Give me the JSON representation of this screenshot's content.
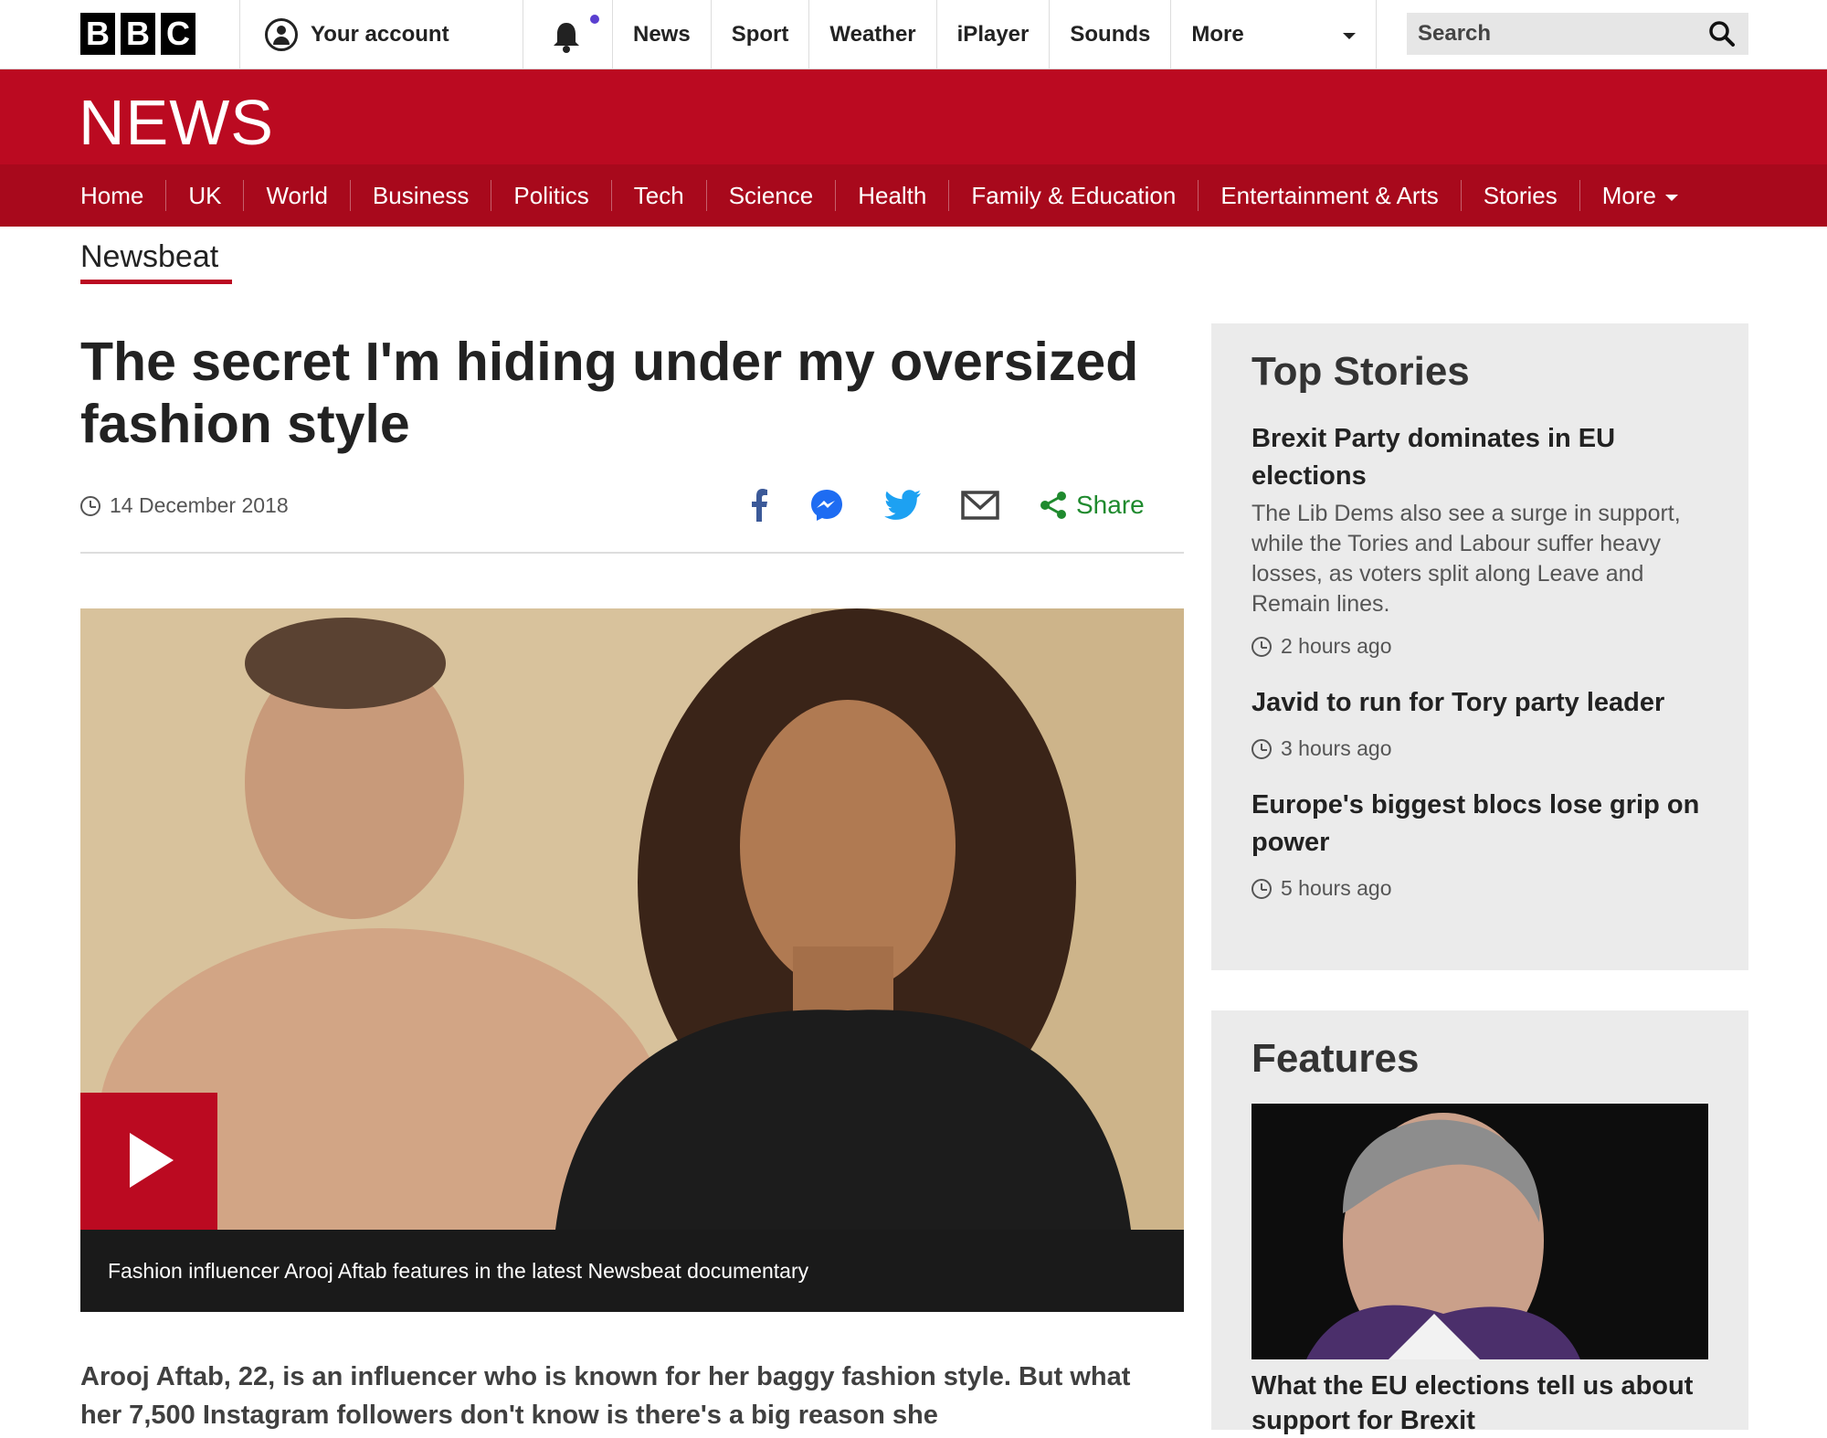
{
  "topbar": {
    "logo_letters": [
      "B",
      "B",
      "C"
    ],
    "account_label": "Your account",
    "nav": [
      "News",
      "Sport",
      "Weather",
      "iPlayer",
      "Sounds",
      "More"
    ],
    "search_placeholder": "Search"
  },
  "masthead": {
    "title": "NEWS",
    "nav": [
      "Home",
      "UK",
      "World",
      "Business",
      "Politics",
      "Tech",
      "Science",
      "Health",
      "Family & Education",
      "Entertainment & Arts",
      "Stories",
      "More"
    ]
  },
  "section": "Newsbeat",
  "article": {
    "headline": "The secret I'm hiding under my oversized fashion style",
    "date": "14 December 2018",
    "share_label": "Share",
    "caption": "Fashion influencer Arooj Aftab features in the latest Newsbeat documentary",
    "intro": "Arooj Aftab, 22, is an influencer who is known for her baggy fashion style. But what her 7,500 Instagram followers don't know is there's a big reason she"
  },
  "top_stories": {
    "title": "Top Stories",
    "items": [
      {
        "headline": "Brexit Party dominates in EU elections",
        "summary": "The Lib Dems also see a surge in support, while the Tories and Labour suffer heavy losses, as voters split along Leave and Remain lines.",
        "time": "2 hours ago"
      },
      {
        "headline": "Javid to run for Tory party leader",
        "summary": "",
        "time": "3 hours ago"
      },
      {
        "headline": "Europe's biggest blocs lose grip on power",
        "summary": "",
        "time": "5 hours ago"
      }
    ]
  },
  "features": {
    "title": "Features",
    "items": [
      {
        "headline": "What the EU elections tell us about support for Brexit"
      }
    ]
  },
  "colors": {
    "brand_red": "#bb0a21",
    "nav_red": "#a8091c",
    "share_green": "#1f8a2e"
  }
}
